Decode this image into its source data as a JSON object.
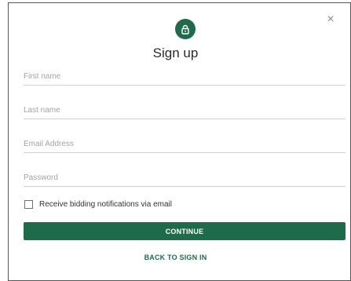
{
  "dialog": {
    "title": "Sign up",
    "close_glyph": "×"
  },
  "fields": {
    "first_name": {
      "placeholder": "First name",
      "value": ""
    },
    "last_name": {
      "placeholder": "Last name",
      "value": ""
    },
    "email": {
      "placeholder": "Email Address",
      "value": ""
    },
    "password": {
      "placeholder": "Password",
      "value": ""
    }
  },
  "notifications": {
    "label": "Receive bidding notifications via email",
    "checked": false
  },
  "actions": {
    "continue_label": "CONTINUE",
    "back_label": "BACK TO SIGN IN"
  },
  "icons": {
    "header": "lock-icon",
    "close": "close-icon"
  },
  "colors": {
    "accent": "#1e6b4a",
    "text": "#2b2b2b",
    "placeholder": "#a3a3a3",
    "divider": "#cfcfcf"
  }
}
